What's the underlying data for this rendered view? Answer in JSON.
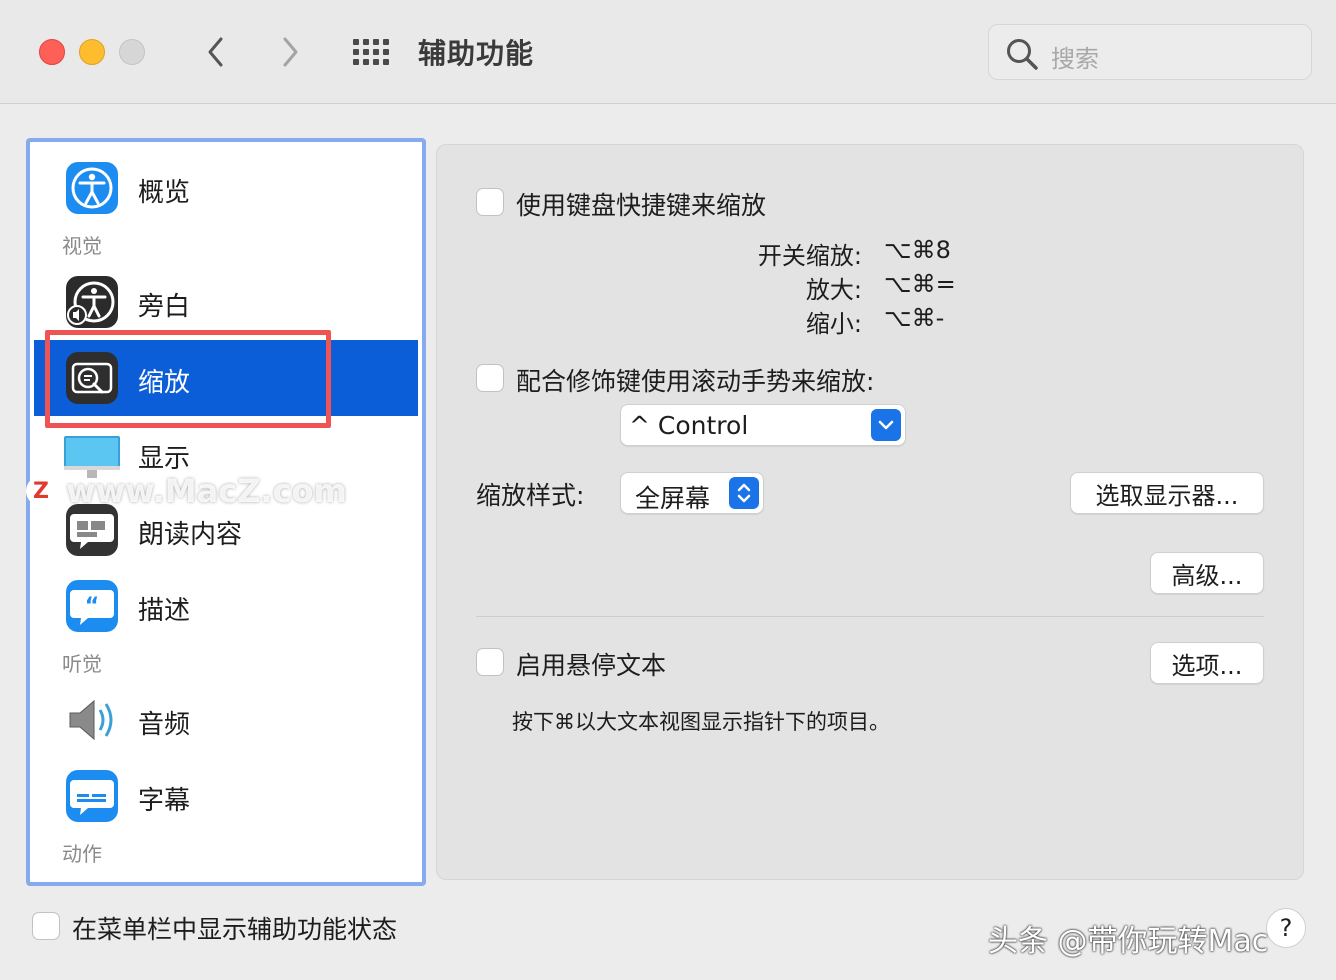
{
  "window": {
    "title": "辅助功能"
  },
  "search": {
    "placeholder": "搜索"
  },
  "sidebar": {
    "items": [
      {
        "label": "概览"
      },
      {
        "label": "旁白"
      },
      {
        "label": "缩放"
      },
      {
        "label": "显示"
      },
      {
        "label": "朗读内容"
      },
      {
        "label": "描述"
      },
      {
        "label": "音频"
      },
      {
        "label": "字幕"
      }
    ],
    "sections": [
      "视觉",
      "听觉",
      "动作"
    ],
    "selected": "缩放"
  },
  "zoom": {
    "keyboard_shortcuts_label": "使用键盘快捷键来缩放",
    "shortcuts": [
      {
        "label": "开关缩放:",
        "keys": "⌥⌘8"
      },
      {
        "label": "放大:",
        "keys": "⌥⌘="
      },
      {
        "label": "缩小:",
        "keys": "⌥⌘-"
      }
    ],
    "scroll_gesture_label": "配合修饰键使用滚动手势来缩放:",
    "modifier_value": "^ Control",
    "style_label": "缩放样式:",
    "style_value": "全屏幕",
    "choose_display_button": "选取显示器...",
    "advanced_button": "高级...",
    "hover_text_label": "启用悬停文本",
    "hover_options_button": "选项...",
    "hover_text_hint": "按下⌘以大文本视图显示指针下的项目。"
  },
  "footer": {
    "menubar_status_label": "在菜单栏中显示辅助功能状态",
    "help_label": "?"
  },
  "watermarks": {
    "site": "www.MacZ.com",
    "site_badge": "Z",
    "credit": "头条 @带你玩转Mac"
  },
  "colors": {
    "selection": "#0b5ed7",
    "highlight_border": "#ef5454",
    "sidebar_border": "#86aaf0",
    "accent": "#1b73e8"
  }
}
